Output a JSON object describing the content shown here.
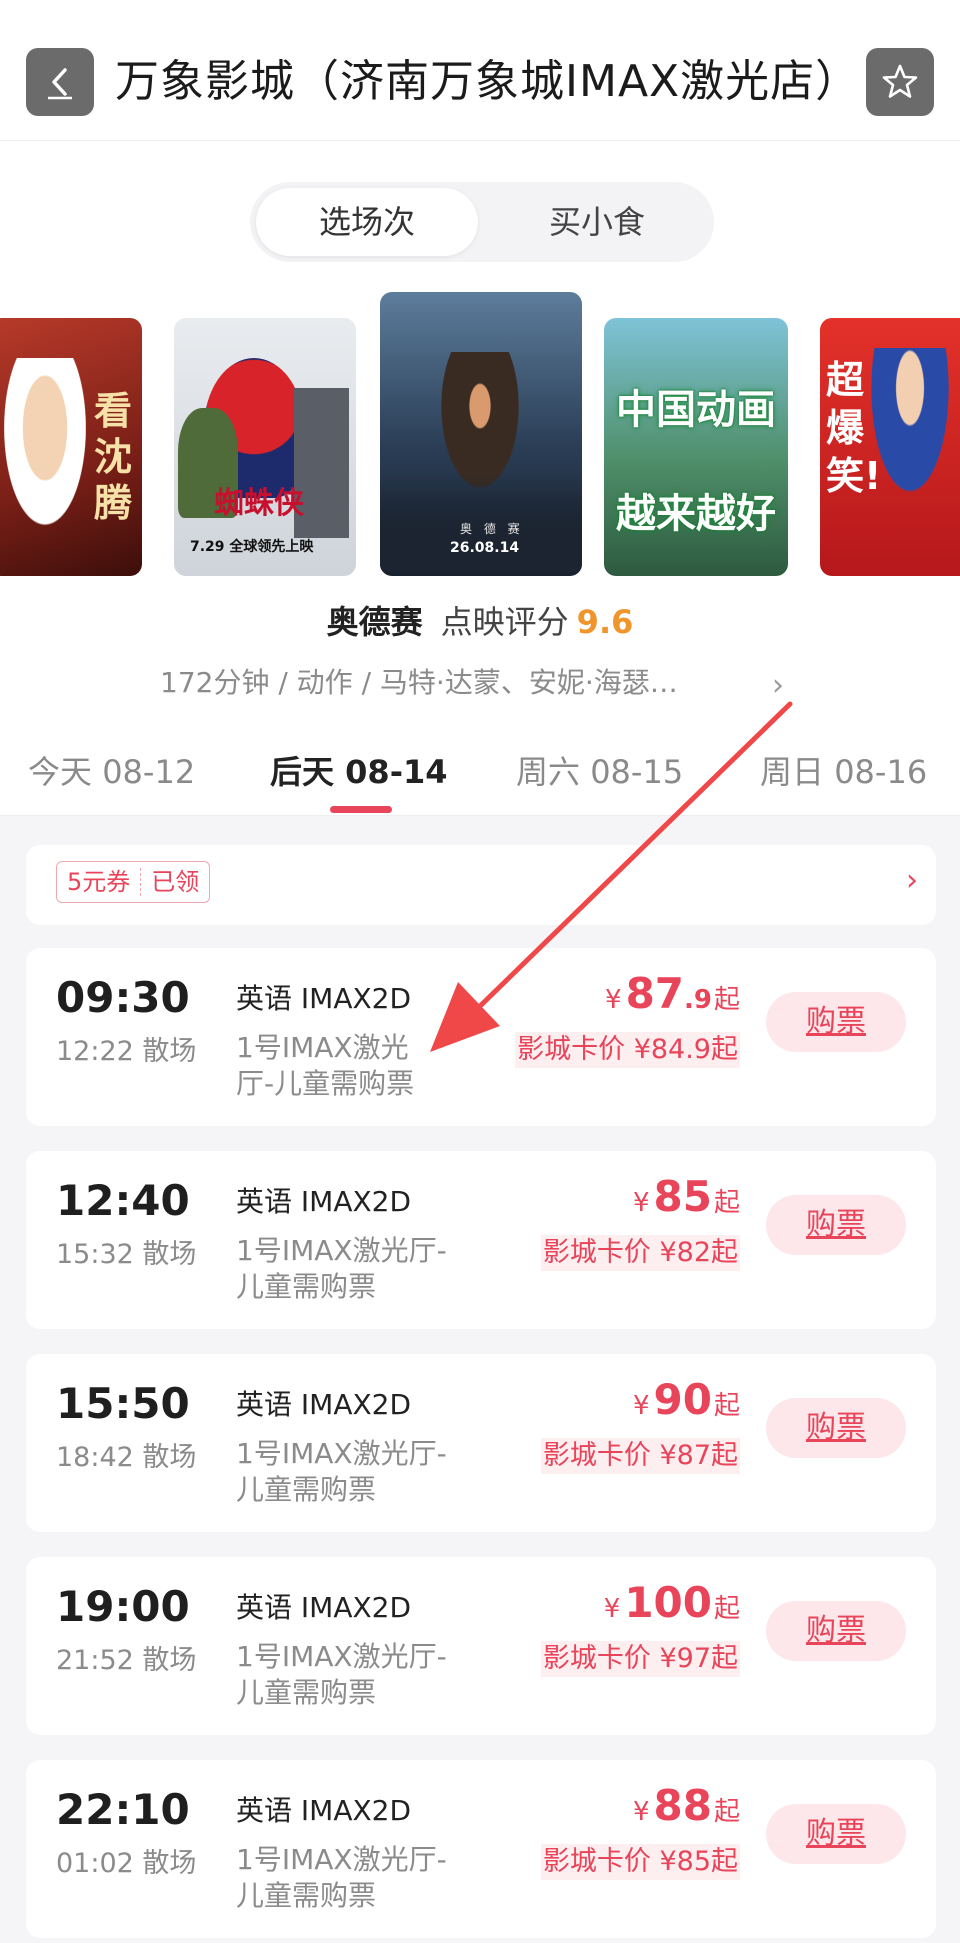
{
  "header": {
    "title": "万象影城（济南万象城IMAX激光店）"
  },
  "segmented": {
    "tabs": [
      {
        "label": "选场次",
        "active": true
      },
      {
        "label": "买小食",
        "active": false
      }
    ]
  },
  "posters": [
    {
      "text": "看沈腾",
      "theme": "food-comedy"
    },
    {
      "text": "7.29 全球领先上映",
      "theme": "spider-man"
    },
    {
      "text": "26.08.14",
      "theme": "odyssey"
    },
    {
      "text": "中国动画 越来越好",
      "theme": "animation"
    },
    {
      "text": "超爆笑!",
      "theme": "comedy-red"
    }
  ],
  "movie": {
    "name": "奥德赛",
    "score_label": "点映评分",
    "score": "9.6",
    "meta": "172分钟 / 动作 / 马特·达蒙、安妮·海瑟…"
  },
  "date_tabs": [
    {
      "day": "今天",
      "date": "08-12",
      "active": false
    },
    {
      "day": "后天",
      "date": "08-14",
      "active": true
    },
    {
      "day": "周六",
      "date": "08-15",
      "active": false
    },
    {
      "day": "周日",
      "date": "08-16",
      "active": false
    }
  ],
  "coupon": {
    "amount": "5元券",
    "status": "已领"
  },
  "showtimes": [
    {
      "start": "09:30",
      "end": "12:22 散场",
      "lang": "英语 IMAX2D",
      "hall_line1": "1号IMAX激光",
      "hall_line2": "厅-儿童需购票",
      "yen": "¥",
      "price_int": "87",
      "price_dec": ".9",
      "qi": "起",
      "card_price": "影城卡价 ¥84.9起",
      "buy": "购票"
    },
    {
      "start": "12:40",
      "end": "15:32 散场",
      "lang": "英语 IMAX2D",
      "hall_line1": "1号IMAX激光厅-",
      "hall_line2": "儿童需购票",
      "yen": "¥",
      "price_int": "85",
      "price_dec": "",
      "qi": "起",
      "card_price": "影城卡价 ¥82起",
      "buy": "购票"
    },
    {
      "start": "15:50",
      "end": "18:42 散场",
      "lang": "英语 IMAX2D",
      "hall_line1": "1号IMAX激光厅-",
      "hall_line2": "儿童需购票",
      "yen": "¥",
      "price_int": "90",
      "price_dec": "",
      "qi": "起",
      "card_price": "影城卡价 ¥87起",
      "buy": "购票"
    },
    {
      "start": "19:00",
      "end": "21:52 散场",
      "lang": "英语 IMAX2D",
      "hall_line1": "1号IMAX激光厅-",
      "hall_line2": "儿童需购票",
      "yen": "¥",
      "price_int": "100",
      "price_dec": "",
      "qi": "起",
      "card_price": "影城卡价 ¥97起",
      "buy": "购票"
    },
    {
      "start": "22:10",
      "end": "01:02 散场",
      "lang": "英语 IMAX2D",
      "hall_line1": "1号IMAX激光厅-",
      "hall_line2": "儿童需购票",
      "yen": "¥",
      "price_int": "88",
      "price_dec": "",
      "qi": "起",
      "card_price": "影城卡价 ¥85起",
      "buy": "购票"
    }
  ],
  "colors": {
    "accent": "#e8445a",
    "score": "#f0952c",
    "annotation_arrow": "#f04848"
  }
}
